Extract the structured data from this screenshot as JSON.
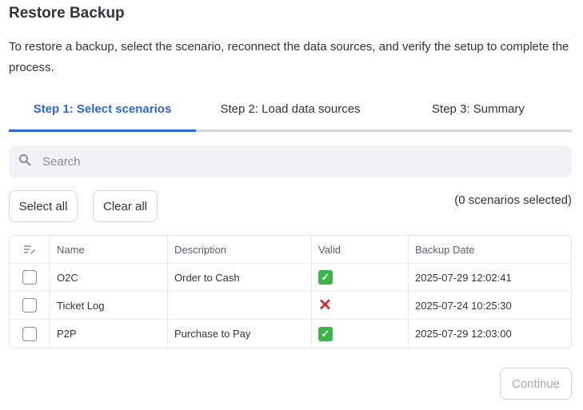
{
  "page": {
    "title": "Restore Backup",
    "description": "To restore a backup, select the scenario, reconnect the data sources, and verify the setup to complete the process."
  },
  "tabs": [
    {
      "label": "Step 1: Select scenarios",
      "active": true
    },
    {
      "label": "Step 2: Load data sources",
      "active": false
    },
    {
      "label": "Step 3: Summary",
      "active": false
    }
  ],
  "search": {
    "placeholder": "Search",
    "value": ""
  },
  "actions": {
    "select_all": "Select all",
    "clear_all": "Clear all",
    "selected_count": "(0 scenarios selected)"
  },
  "table": {
    "columns": [
      "Name",
      "Description",
      "Valid",
      "Backup Date"
    ],
    "rows": [
      {
        "name": "O2C",
        "description": "Order to Cash",
        "valid": true,
        "backup_date": "2025-07-29 12:02:41",
        "selected": false
      },
      {
        "name": "Ticket Log",
        "description": "",
        "valid": false,
        "backup_date": "2025-07-24 10:25:30",
        "selected": false
      },
      {
        "name": "P2P",
        "description": "Purchase to Pay",
        "valid": true,
        "backup_date": "2025-07-29 12:03:00",
        "selected": false
      }
    ]
  },
  "footer": {
    "continue_label": "Continue",
    "continue_enabled": false
  },
  "colors": {
    "accent": "#2f66d6",
    "valid": "#3bb54a",
    "invalid": "#d62929"
  }
}
